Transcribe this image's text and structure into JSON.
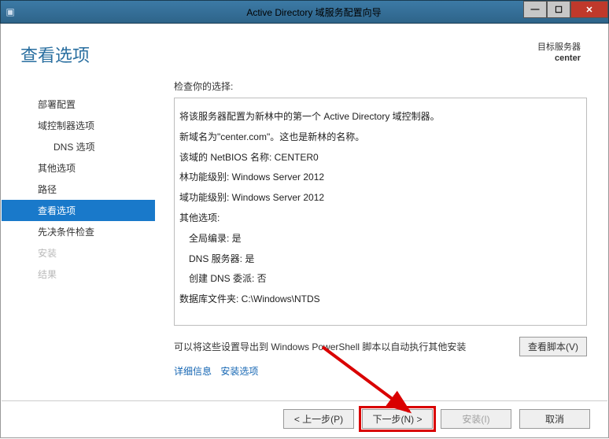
{
  "titlebar": {
    "title": "Active Directory 域服务配置向导"
  },
  "header": {
    "page_title": "查看选项",
    "target_label": "目标服务器",
    "target_server": "center"
  },
  "sidebar": {
    "items": [
      {
        "label": "部署配置",
        "state": "n"
      },
      {
        "label": "域控制器选项",
        "state": "n"
      },
      {
        "label": "DNS 选项",
        "state": "sub"
      },
      {
        "label": "其他选项",
        "state": "n"
      },
      {
        "label": "路径",
        "state": "n"
      },
      {
        "label": "查看选项",
        "state": "sel"
      },
      {
        "label": "先决条件检查",
        "state": "n"
      },
      {
        "label": "安装",
        "state": "dis"
      },
      {
        "label": "结果",
        "state": "dis"
      }
    ]
  },
  "main": {
    "instruction": "检查你的选择:",
    "lines": [
      {
        "t": "将该服务器配置为新林中的第一个 Active Directory 域控制器。",
        "i": false
      },
      {
        "t": "新域名为\"center.com\"。这也是新林的名称。",
        "i": false
      },
      {
        "t": "该域的 NetBIOS 名称: CENTER0",
        "i": false
      },
      {
        "t": "林功能级别: Windows Server 2012",
        "i": false
      },
      {
        "t": "域功能级别: Windows Server 2012",
        "i": false
      },
      {
        "t": "其他选项:",
        "i": false
      },
      {
        "t": "全局编录: 是",
        "i": true
      },
      {
        "t": "DNS 服务器: 是",
        "i": true
      },
      {
        "t": "创建 DNS 委派: 否",
        "i": true
      },
      {
        "t": "数据库文件夹: C:\\Windows\\NTDS",
        "i": false
      }
    ],
    "export_hint": "可以将这些设置导出到 Windows PowerShell 脚本以自动执行其他安装",
    "view_script_btn": "查看脚本(V)",
    "link_details": "详细信息",
    "link_install_options": "安装选项"
  },
  "footer": {
    "prev": "< 上一步(P)",
    "next": "下一步(N) >",
    "install": "安装(I)",
    "cancel": "取消"
  }
}
